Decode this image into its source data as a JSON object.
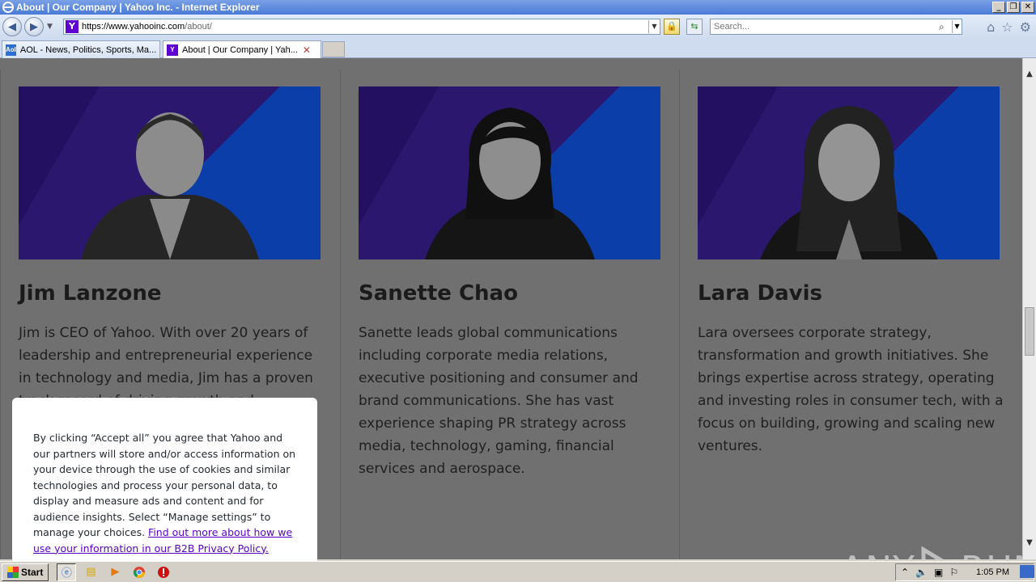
{
  "window": {
    "title": "About | Our Company | Yahoo Inc. - Internet Explorer"
  },
  "navbar": {
    "url_host": "https://www.yahooinc.com",
    "url_path": "/about/",
    "search_placeholder": "Search..."
  },
  "tabs": [
    {
      "label": "AOL - News, Politics, Sports, Ma...",
      "icon": "aol-icon",
      "active": false
    },
    {
      "label": "About | Our Company | Yah...",
      "icon": "yahoo-icon",
      "active": true
    }
  ],
  "people": [
    {
      "name": "Jim Lanzone",
      "bio": "Jim is CEO of Yahoo. With over 20 years of leadership and entrepreneurial experience in technology and media, Jim has a proven track record of driving growth and innovation. Prior"
    },
    {
      "name": "Sanette Chao",
      "bio": "Sanette leads global communications including corporate media relations, executive positioning and consumer and brand communications. She has vast experience shaping PR strategy across media, technology, gaming, financial services and aerospace."
    },
    {
      "name": "Lara Davis",
      "bio": "Lara oversees corporate strategy, transformation and growth initiatives.  She brings expertise across strategy, operating and investing roles in consumer tech, with a focus on building, growing and scaling new ventures."
    }
  ],
  "cookie": {
    "text": "By clicking “Accept all” you agree that Yahoo and our partners will store and/or access information on your device through the use of cookies and similar technologies and process your personal data, to display and measure ads and content and for audience insights. Select “Manage settings” to manage your choices. ",
    "link": "Find out more about how we use your information in our B2B Privacy Policy."
  },
  "watermark": {
    "left": "ANY",
    "right": "RUN"
  },
  "taskbar": {
    "start_label": "Start",
    "clock": "1:05 PM"
  }
}
